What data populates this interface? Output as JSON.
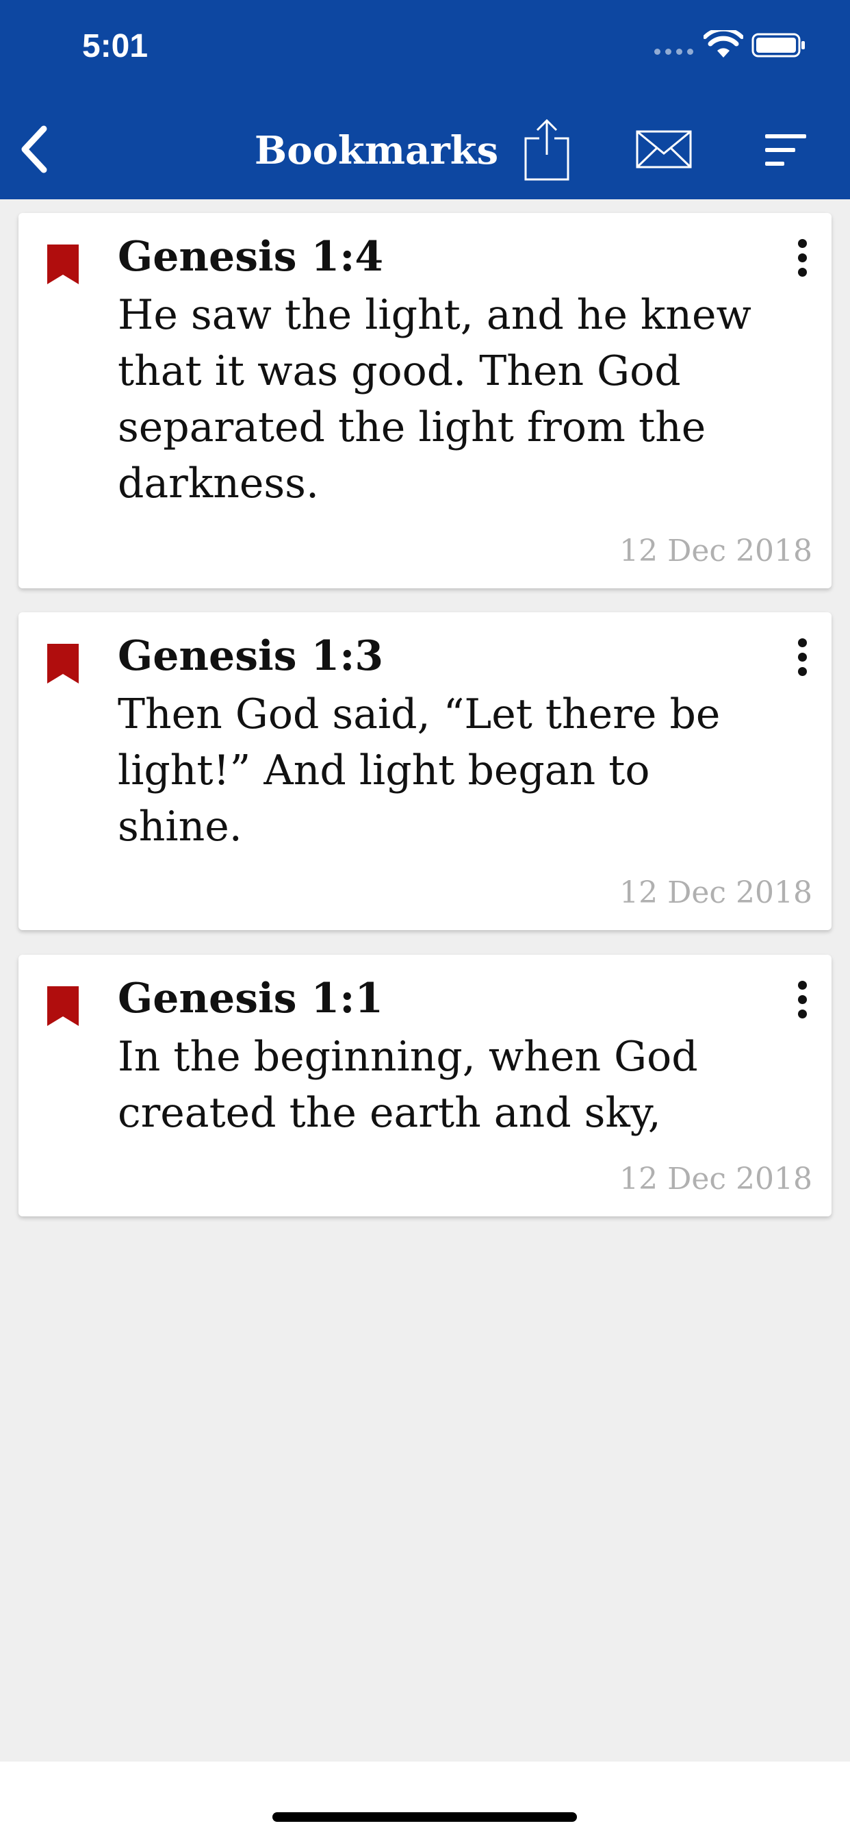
{
  "status_bar": {
    "time": "5:01"
  },
  "nav": {
    "title": "Bookmarks"
  },
  "bookmarks": [
    {
      "reference": "Genesis 1:4",
      "text": "He saw the light, and he knew that it was good. Then God separated the light from the darkness.",
      "date": "12 Dec 2018"
    },
    {
      "reference": "Genesis 1:3",
      "text": "Then God said, “Let there be light!” And light began to shine.",
      "date": "12 Dec 2018"
    },
    {
      "reference": "Genesis 1:1",
      "text": "In the beginning, when God created the earth and sky,",
      "date": "12 Dec 2018"
    }
  ],
  "icons": {
    "back": "back-chevron-icon",
    "share": "share-icon",
    "mail": "mail-icon",
    "sort": "sort-icon",
    "bookmark": "bookmark-icon",
    "more": "more-vertical-icon"
  },
  "colors": {
    "header": "#0d47a1",
    "bookmark": "#b00d0d",
    "background": "#efefef",
    "date_text": "#b0b0b0"
  }
}
